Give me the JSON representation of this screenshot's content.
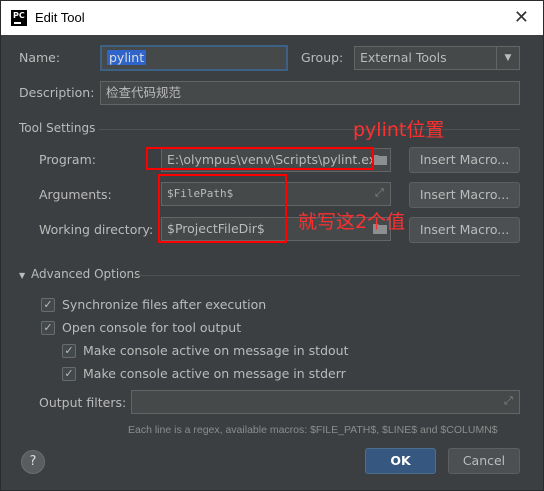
{
  "window": {
    "title": "Edit Tool",
    "app_icon_text": "PC"
  },
  "form": {
    "name_label": "Name:",
    "name_value": "pylint",
    "group_label": "Group:",
    "group_value": "External Tools",
    "description_label": "Description:",
    "description_value": "检查代码规范"
  },
  "tool_settings": {
    "section_label": "Tool Settings",
    "program_label": "Program:",
    "program_value": "E:\\olympus\\venv\\Scripts\\pylint.exe",
    "arguments_label": "Arguments:",
    "arguments_value": "$FilePath$",
    "working_dir_label": "Working directory:",
    "working_dir_value": "$ProjectFileDir$",
    "insert_macro_label": "Insert Macro..."
  },
  "advanced": {
    "section_label": "Advanced Options",
    "options": [
      {
        "label": "Synchronize files after execution",
        "checked": true
      },
      {
        "label": "Open console for tool output",
        "checked": true
      },
      {
        "label": "Make console active on message in stdout",
        "checked": true
      },
      {
        "label": "Make console active on message in stderr",
        "checked": true
      }
    ],
    "output_filters_label": "Output filters:",
    "output_filters_value": "",
    "hint": "Each line is a regex, available macros: $FILE_PATH$, $LINE$ and $COLUMN$"
  },
  "annotations": {
    "program_note": "pylint位置",
    "args_note": "就写这2个值",
    "color": "#ff0000"
  },
  "footer": {
    "help_label": "?",
    "ok_label": "OK",
    "cancel_label": "Cancel"
  },
  "colors": {
    "dialog_bg": "#3c3f41",
    "field_bg": "#45494a",
    "ok_button": "#365880",
    "selection": "#2f65ca"
  }
}
